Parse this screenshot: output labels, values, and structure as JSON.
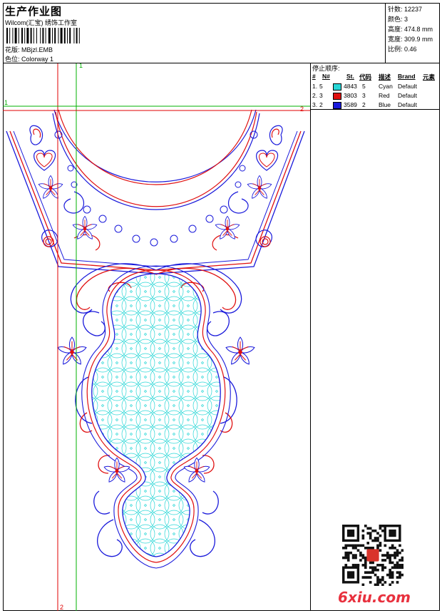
{
  "header": {
    "title": "生产作业图",
    "subtitle": "Wilcom(汇宝) 绣饰工作室",
    "design_label": "花版:",
    "design_value": "MBjzl.EMB",
    "colorway_label": "色位:",
    "colorway_value": "Colorway 1"
  },
  "stats": [
    {
      "label": "针数:",
      "value": "12237"
    },
    {
      "label": "颜色:",
      "value": "3"
    },
    {
      "label": "高度:",
      "value": "474.8 mm"
    },
    {
      "label": "宽度:",
      "value": "309.9 mm"
    },
    {
      "label": "比例:",
      "value": "0.46"
    }
  ],
  "legend": {
    "title": "停止顺序:",
    "columns": [
      "#",
      "N#",
      "St.",
      "代码",
      "描述",
      "Brand",
      "元素"
    ],
    "rows": [
      {
        "index": "1.",
        "n": "5",
        "stitches": "4843",
        "code": "5",
        "desc": "Cyan",
        "brand": "Default",
        "color": "#27d6d6"
      },
      {
        "index": "2.",
        "n": "3",
        "stitches": "3803",
        "code": "3",
        "desc": "Red",
        "brand": "Default",
        "color": "#e01010"
      },
      {
        "index": "3.",
        "n": "2",
        "stitches": "3589",
        "code": "2",
        "desc": "Blue",
        "brand": "Default",
        "color": "#1a1adb"
      }
    ]
  },
  "guides": {
    "v_red_top": "1",
    "v_red_bottom": "2",
    "h_green_left": "1",
    "h_red_right": "2"
  },
  "watermark": "6xiu.com",
  "colors": {
    "cyan": "#27d6d6",
    "red": "#e01010",
    "blue": "#1a1adb",
    "guide_green": "#00b000",
    "guide_red": "#e00000"
  }
}
